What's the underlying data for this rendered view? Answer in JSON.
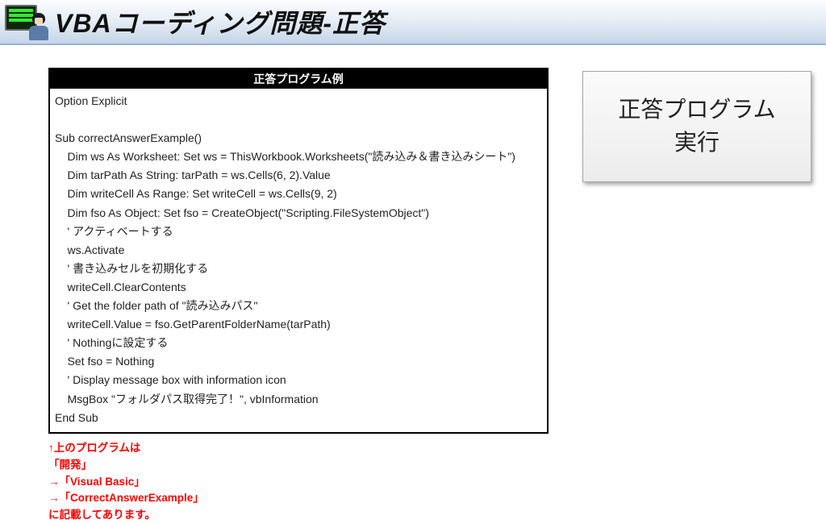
{
  "title": "VBAコーディング問題-正答",
  "code_header": "正答プログラム例",
  "code_body": "Option Explicit\n\nSub correctAnswerExample()\n    Dim ws As Worksheet: Set ws = ThisWorkbook.Worksheets(\"読み込み＆書き込みシート\")\n    Dim tarPath As String: tarPath = ws.Cells(6, 2).Value\n    Dim writeCell As Range: Set writeCell = ws.Cells(9, 2)\n    Dim fso As Object: Set fso = CreateObject(\"Scripting.FileSystemObject\")\n    ' アクティベートする\n    ws.Activate\n    ' 書き込みセルを初期化する\n    writeCell.ClearContents\n    ' Get the folder path of \"読み込みパス\"\n    writeCell.Value = fso.GetParentFolderName(tarPath)\n    ' Nothingに設定する\n    Set fso = Nothing\n    ' Display message box with information icon\n    MsgBox \"フォルダパス取得完了！\", vbInformation\nEnd Sub",
  "notes": "↑上のプログラムは\n「開発」\n→「Visual Basic」\n→「CorrectAnswerExample」\nに記載してあります。",
  "run_button": "正答プログラム\n実行"
}
